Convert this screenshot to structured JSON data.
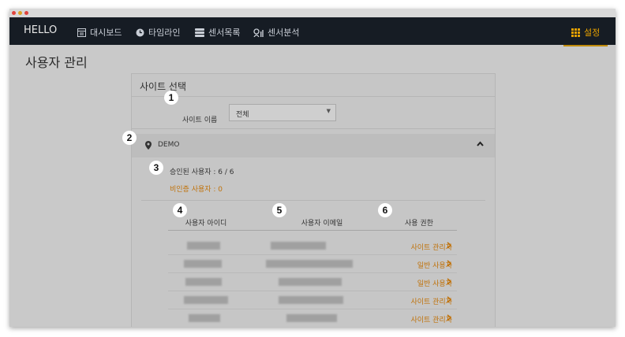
{
  "app": {
    "brand": "HELLO"
  },
  "nav": {
    "items": [
      {
        "label": "대시보드",
        "icon": "dashboard-icon"
      },
      {
        "label": "타임라인",
        "icon": "clock-icon"
      },
      {
        "label": "센서목록",
        "icon": "list-icon"
      },
      {
        "label": "센서분석",
        "icon": "analytics-icon"
      }
    ],
    "settings": {
      "label": "설정",
      "icon": "grid-icon"
    }
  },
  "page": {
    "title": "사용자 관리"
  },
  "site_select": {
    "title": "사이트 선택",
    "label": "사이트 이름",
    "value": "전체"
  },
  "site": {
    "name": "DEMO",
    "approved": "승인된 사용자 : 6 / 6",
    "pending": "비인증 사용자 : 0"
  },
  "table": {
    "headers": [
      "사용자 아이디",
      "사용자 이메일",
      "사용 권한"
    ],
    "rows": [
      {
        "role": "사이트 관리자"
      },
      {
        "role": "일반 사용자"
      },
      {
        "role": "일반 사용자"
      },
      {
        "role": "사이트 관리자"
      },
      {
        "role": "사이트 관리자"
      }
    ]
  },
  "callouts": [
    "1",
    "2",
    "3",
    "4",
    "5",
    "6"
  ],
  "colors": {
    "navbar": "#161c24",
    "accent": "#e5a000",
    "role_text": "#c0720a"
  }
}
